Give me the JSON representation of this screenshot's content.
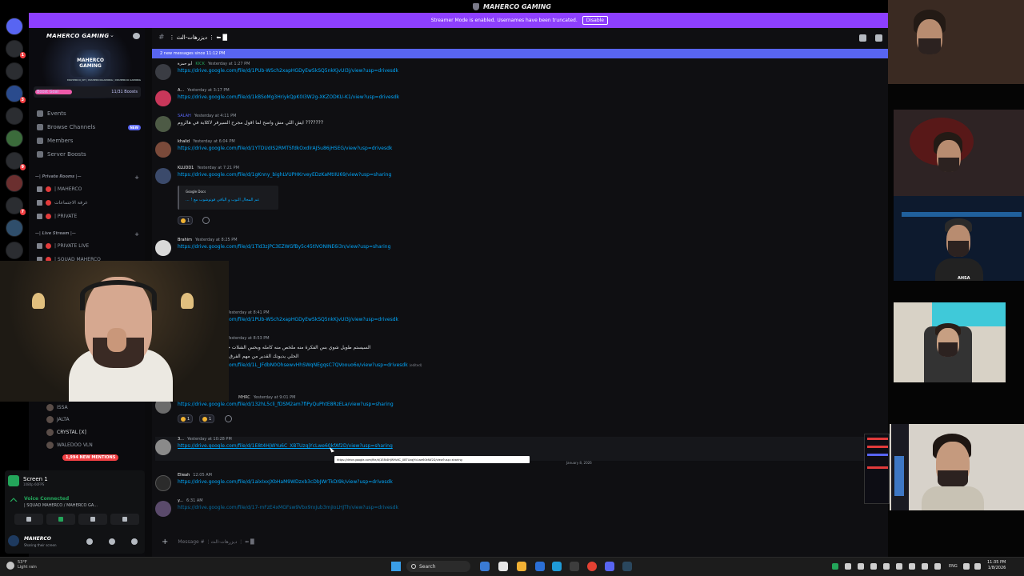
{
  "window": {
    "title": "MAHERCO GAMING"
  },
  "streamer_banner": {
    "text": "Streamer Mode is enabled. Usernames have been truncated.",
    "button": "Disable"
  },
  "guild": {
    "name": "MAHERCO GAMING",
    "logo_text": "MAHERCO GAMING",
    "socials": "MAHERCO_NT | MAHERCOGAMING | MAHERCO GAMING",
    "boost_label": "Boost Goal",
    "boost_count": "11/31 Boosts",
    "boost_progress": 0.35
  },
  "nav": {
    "events": "Events",
    "browse": "Browse Channels",
    "browse_badge": "NEW",
    "members": "Members",
    "server_boosts": "Server Boosts"
  },
  "categories": {
    "private": "—| Private Rooms |—",
    "live": "—| Live Stream |—"
  },
  "voice_channels": {
    "ch1": "| MAHERCO",
    "ch2": "غرفة الاجتماعات",
    "ch3": "| PRIVATE",
    "ch4": "| PRIVATE LIVE",
    "ch5": "| SQUAD MAHERCO"
  },
  "voice_members": [
    "ISSA",
    "JALTA",
    "CRYSTAL [X]",
    "WALEDOO VLN"
  ],
  "mentions_badge": "1,994 NEW MENTIONS",
  "screen_share": {
    "title": "Screen 1",
    "sub": "1080p 60FPS"
  },
  "voice": {
    "status": "Voice Connected",
    "channel": "| SQUAD MAHERCO / MAHERCO GA..."
  },
  "me": {
    "name": "MAHERCO",
    "status": "Sharing their screen"
  },
  "channel": {
    "name": "⋮ ديزرهات-الث ⋮ ⬅ █"
  },
  "new_messages_bar": "2 new messages since 11:12 PM",
  "messages": [
    {
      "author": "أبو حمزة",
      "tag": "KICK",
      "time": "Yesterday at 1:27 PM",
      "link": "https://drive.google.com/file/d/1PUb-WSch2xapHGDyEwSkSQ5nkKjvUI3j/view?usp=drivesdk"
    },
    {
      "author": "A...",
      "tag": "",
      "time": "Yesterday at 3:17 PM",
      "link": "https://drive.google.com/file/d/1kBSoMg3HriykQpK0I3W2g-XKZODKU-K1/view?usp=drivesdk"
    },
    {
      "author": "SALAH",
      "tag": "",
      "time": "Yesterday at 4:11 PM",
      "text": "??????? ايش اللي مش واضح لما اقول مجرح السيرفر لاكلابة في هالروم"
    },
    {
      "author": "khalid",
      "tag": "",
      "time": "Yesterday at 6:04 PM",
      "link": "https://drive.google.com/file/d/1YTDUdIS2RMT5fdkOxdlrAJ5u86jHSEG/view?usp=drivesdk"
    },
    {
      "author": "KLUDD1",
      "tag": "",
      "time": "Yesterday at 7:21 PM",
      "link": "https://drive.google.com/file/d/1gKnny_bighLVUPHKrveyEDzKaMtIIU69/view?usp=sharing"
    },
    {
      "author": "Brahim",
      "tag": "",
      "time": "Yesterday at 8:25 PM",
      "link": "https://drive.google.com/file/d/1Tld3zjPC3EZWGfBy5c45tlVONINE6i3n/view?usp=sharing"
    },
    {
      "author": "",
      "tag": "",
      "time": "Yesterday at 8:41 PM",
      "link": "https://drive.google.com/file/d/1PUb-WSch2xapHGDyEwSkSQ5nkKjvUI3j/view?usp=drivesdk"
    },
    {
      "author": "",
      "tag": "",
      "time": "Yesterday at 8:53 PM",
      "text": "السيستم طويل شوي بس الفكرة منه ملخص منه كامله وبحس الشلات حطيتها والعدد القديم بيسم",
      "text2": "الحلي يديونك القدير من مهم الفرق اللهم شارك ان تورجك بلا",
      "link": "https://drive.google.com/file/d/1L_JFdbN0OhsewvHhSWqNEgqsC7QVoouo6o/view?usp=drivesdk",
      "edited": "(edited)"
    },
    {
      "author": "",
      "tag": "MHRC",
      "time": "Yesterday at 9:01 PM",
      "link": "https://drive.google.com/file/d/132hL5cli_fDSM2am7fiPyQuPhtE8RzELa/view?usp=sharing"
    },
    {
      "author": "3...",
      "tag": "",
      "time": "Yesterday at 10:28 PM",
      "link": "https://drive.google.com/file/d/1E8t4HjWYu6C_XBTUzqjYcLwe60kfAf2D/view?usp=sharing"
    },
    {
      "author": "Elieah",
      "tag": "",
      "time": "12:05 AM",
      "link": "https://drive.google.com/file/d/1alxIxxJXbHaM9WDzxb3cDbJWrTkDI9k/view?usp=drivesdk"
    },
    {
      "author": "y...",
      "tag": "",
      "time": "6:31 AM",
      "link": "https://drive.google.com/file/d/17-mFzE4xMGFsw9Vbx9rxJub3mjIoLHJTh/view?usp=drivesdk"
    }
  ],
  "embed": {
    "provider": "Google Docs",
    "title": "عم المجال التوب و الياقي فوتوشوب مع ! ..."
  },
  "reactions": {
    "r1": "1",
    "r2": "1",
    "r3": "1"
  },
  "tooltip": "https://drive.google.com/file/d/1E8t4HjWYu6C_XBTUzqjYcLwe60kfAf2D/view?usp=sharing",
  "date_separator": "January 8, 2026",
  "composer": {
    "placeholder": "Message # ⋮ديزرهات-الث ⋮ ⬅ █"
  },
  "slowmode": "Slowmode enabled",
  "webcams": {
    "label3": "AHSA"
  },
  "taskbar": {
    "temp": "53°F",
    "weather": "Light rain",
    "search": "Search",
    "lang": "ENG",
    "time": "11:35 PM",
    "date": "1/8/2026"
  }
}
